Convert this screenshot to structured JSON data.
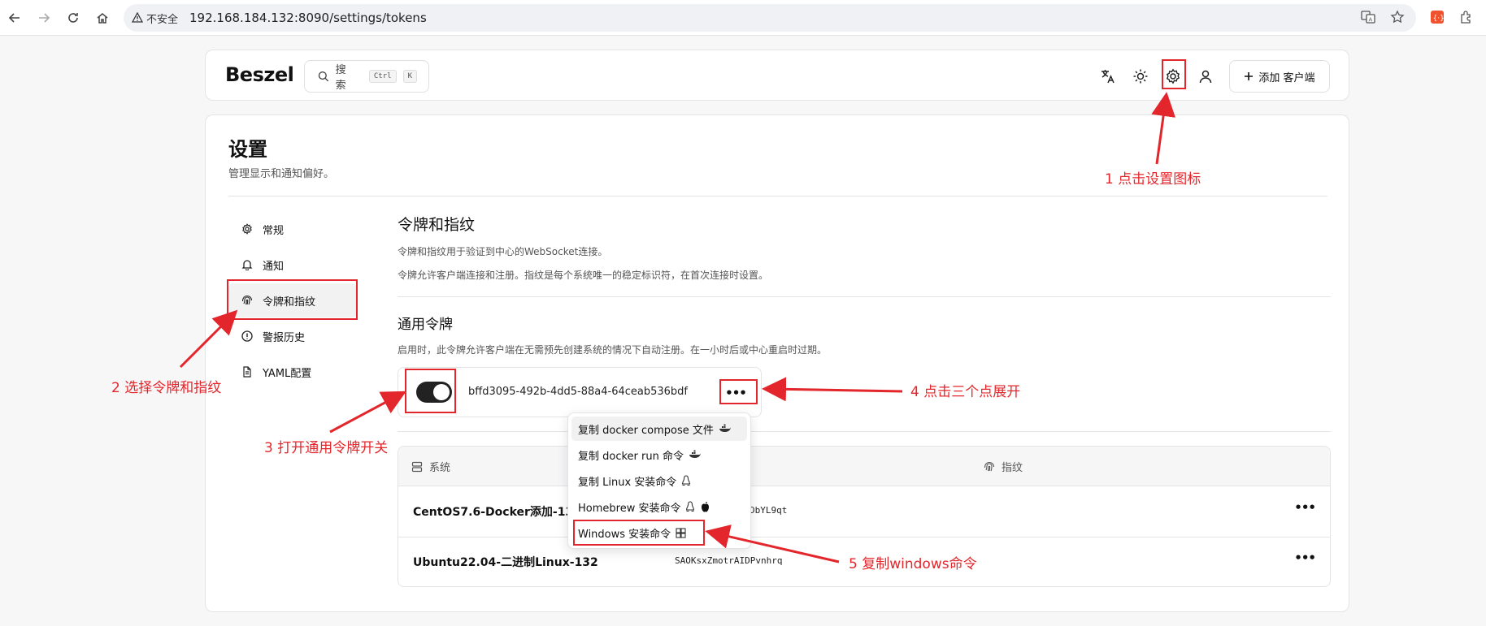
{
  "browser": {
    "security_label": "不安全",
    "url": "192.168.184.132:8090/settings/tokens"
  },
  "header": {
    "logo": "Beszel",
    "search_label": "搜索",
    "kbd_ctrl": "Ctrl",
    "kbd_k": "K",
    "add_client_label": "添加 客户端"
  },
  "page": {
    "title": "设置",
    "subtitle": "管理显示和通知偏好。"
  },
  "sidebar": {
    "items": [
      {
        "label": "常规"
      },
      {
        "label": "通知"
      },
      {
        "label": "令牌和指纹"
      },
      {
        "label": "警报历史"
      },
      {
        "label": "YAML配置"
      }
    ]
  },
  "tokens_section": {
    "title": "令牌和指纹",
    "desc1": "令牌和指纹用于验证到中心的WebSocket连接。",
    "desc2": "令牌允许客户端连接和注册。指纹是每个系统唯一的稳定标识符，在首次连接时设置。"
  },
  "universal_token": {
    "title": "通用令牌",
    "desc": "启用时，此令牌允许客户端在无需预先创建系统的情况下自动注册。在一小时后或中心重启时过期。",
    "enabled": true,
    "token": "bffd3095-492b-4dd5-88a4-64ceab536bdf"
  },
  "menu": {
    "items": [
      {
        "label": "复制 docker compose 文件"
      },
      {
        "label": "复制 docker run 命令"
      },
      {
        "label": "复制 Linux 安装命令"
      },
      {
        "label": "Homebrew 安装命令"
      },
      {
        "label": "Windows 安装命令"
      }
    ]
  },
  "table": {
    "col_system": "系统",
    "col_fingerprint": "指纹",
    "rows": [
      {
        "system": "CentOS7.6-Docker添加-133",
        "fingerprint": "DbYL9qt"
      },
      {
        "system": "Ubuntu22.04-二进制Linux-132",
        "fingerprint": "SAOKsxZmotrAIDPvnhrq"
      }
    ]
  },
  "annotations": {
    "a1": "1 点击设置图标",
    "a2": "2 选择令牌和指纹",
    "a3": "3 打开通用令牌开关",
    "a4": "4 点击三个点展开",
    "a5": "5 复制windows命令"
  },
  "colors": {
    "annotation": "#e3262b",
    "toggle_on": "#222222"
  }
}
